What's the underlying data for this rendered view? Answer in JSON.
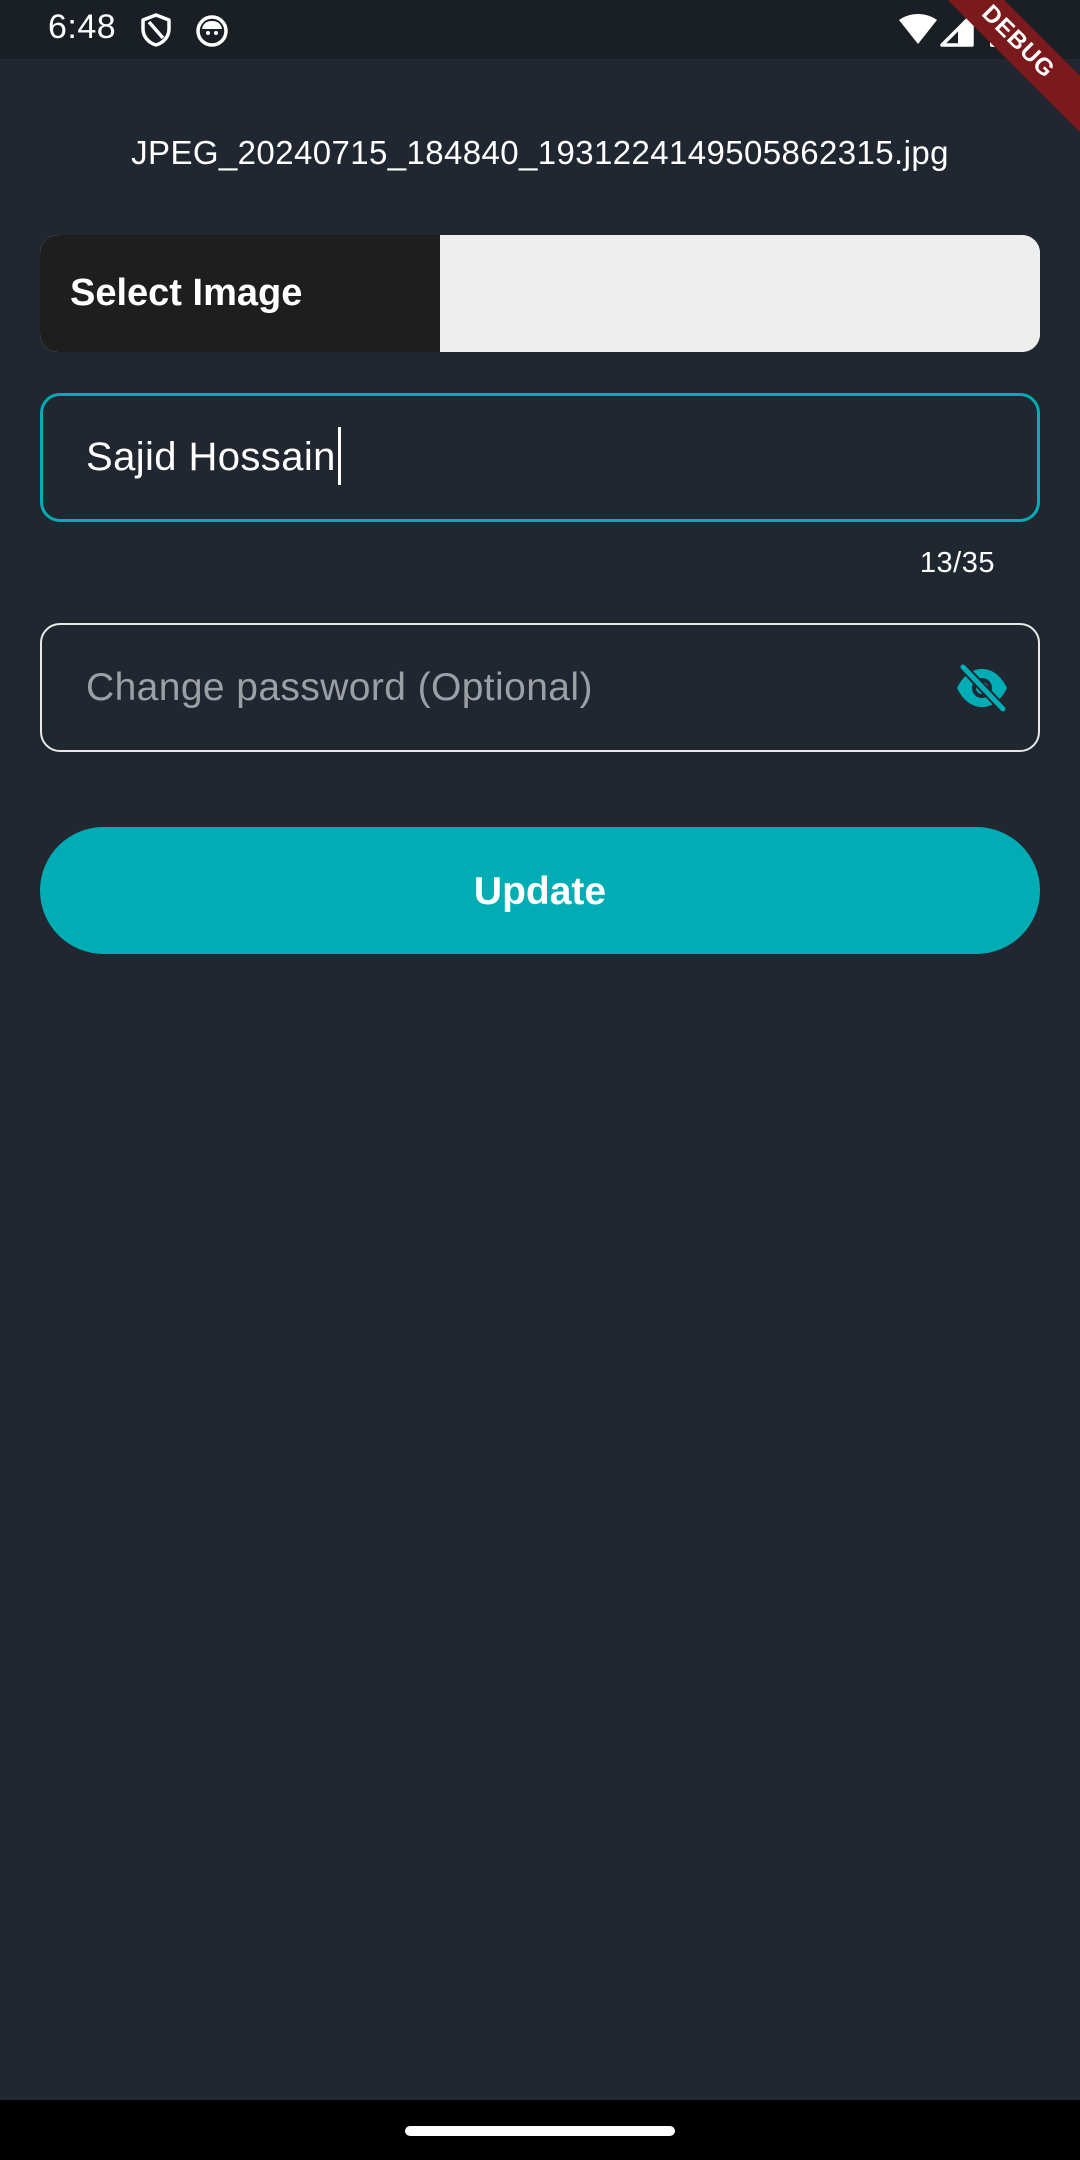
{
  "status_bar": {
    "time": "6:48",
    "icons": [
      "shield-icon",
      "android-debug-icon",
      "wifi-icon",
      "signal-icon",
      "battery-icon"
    ],
    "debug_banner": "DEBUG"
  },
  "form": {
    "file_name": "JPEG_20240715_184840_1931224149505862315.jpg",
    "select_image_label": "Select Image",
    "name_value": "Sajid Hossain",
    "name_counter": "13/35",
    "password_placeholder": "Change password (Optional)",
    "password_visibility_icon": "eye-off-icon",
    "update_label": "Update"
  },
  "colors": {
    "background": "#212731",
    "accent": "#01adb5",
    "picker_button": "#1e1e1e",
    "picker_field": "#eeeeee",
    "debug_ribbon": "#7a1a1c"
  }
}
